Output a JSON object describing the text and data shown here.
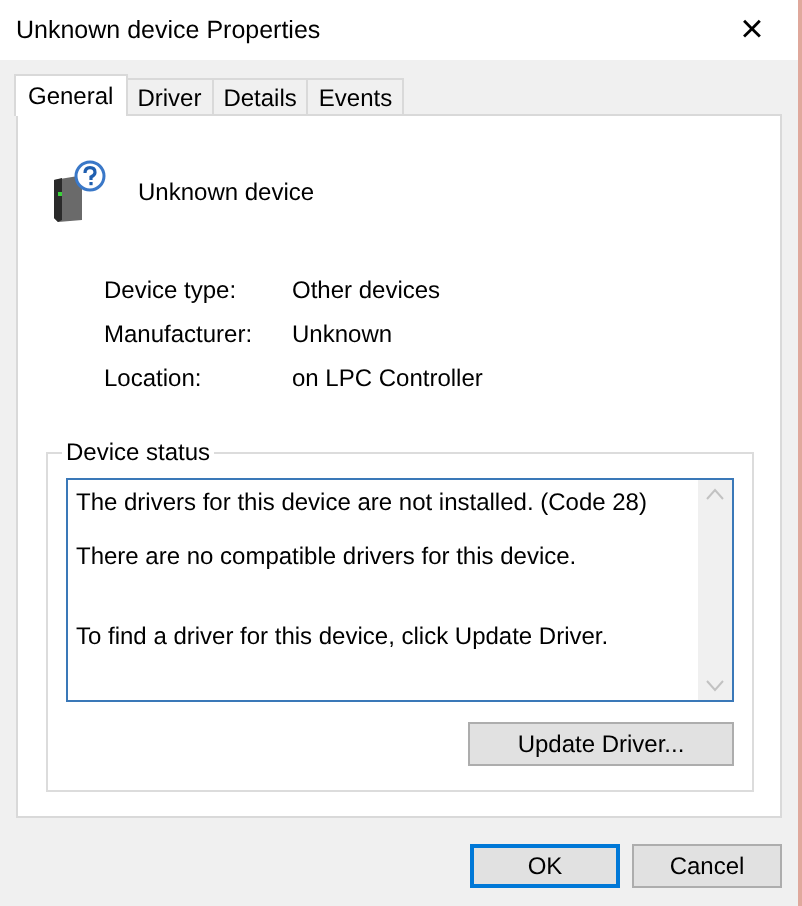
{
  "window": {
    "title": "Unknown device Properties",
    "close": "×"
  },
  "tabs": [
    {
      "label": "General",
      "selected": true
    },
    {
      "label": "Driver",
      "selected": false
    },
    {
      "label": "Details",
      "selected": false
    },
    {
      "label": "Events",
      "selected": false
    }
  ],
  "device": {
    "name": "Unknown device"
  },
  "properties": [
    {
      "label": "Device type:",
      "value": "Other devices"
    },
    {
      "label": "Manufacturer:",
      "value": "Unknown"
    },
    {
      "label": "Location:",
      "value": "on LPC Controller"
    }
  ],
  "device_status": {
    "title": "Device status",
    "lines": [
      "The drivers for this device are not installed. (Code 28)",
      "There are no compatible drivers for this device.",
      "To find a driver for this device, click Update Driver."
    ],
    "button": "Update Driver..."
  },
  "buttons": [
    {
      "label": "OK",
      "default": true
    },
    {
      "label": "Cancel",
      "default": false
    }
  ]
}
